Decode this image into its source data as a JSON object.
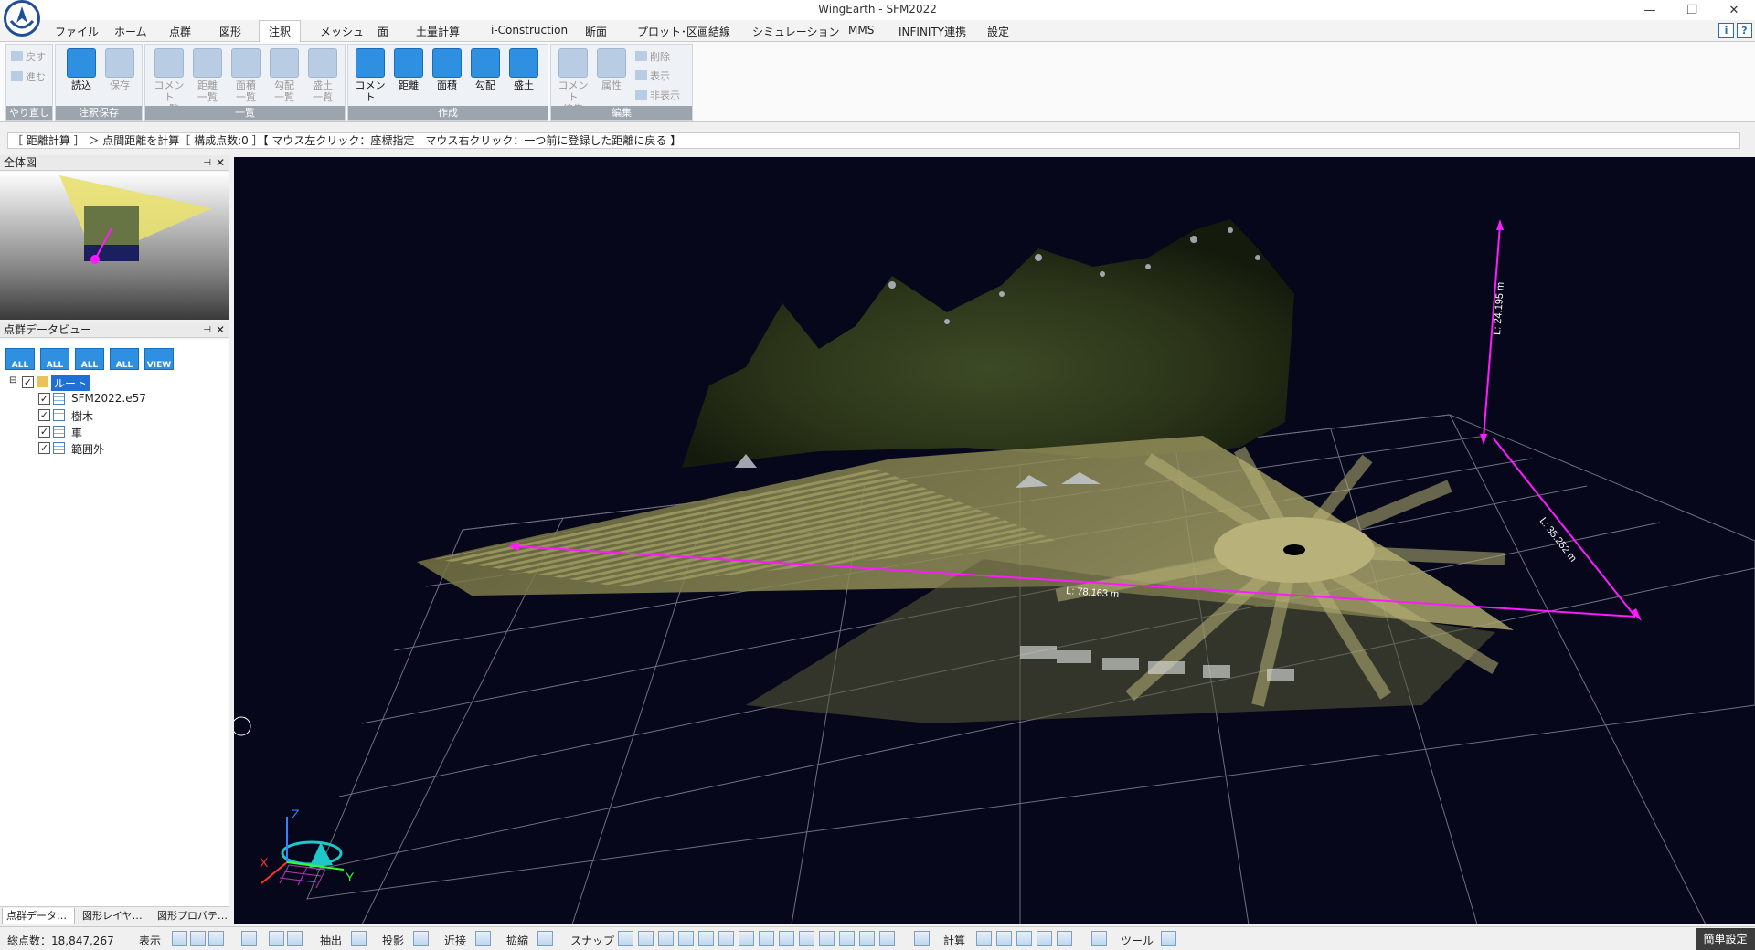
{
  "app": {
    "window_title": "WingEarth - SFM2022"
  },
  "window_controls": {
    "minimize": "—",
    "restore": "❐",
    "close": "✕"
  },
  "menu": {
    "items": [
      "ファイル",
      "ホーム",
      "点群",
      "図形",
      "注釈",
      "メッシュ",
      "面",
      "土量計算",
      "i-Construction",
      "断面",
      "プロット･区画結線",
      "シミュレーション",
      "MMS",
      "INFINITY連携",
      "設定"
    ],
    "active": "注釈",
    "help_icons": [
      "i",
      "?"
    ]
  },
  "ribbon": {
    "undo_group": {
      "undo": "戻す",
      "redo": "進む",
      "label": "やり直し"
    },
    "save_group": {
      "load": "読込",
      "save": "保存",
      "label": "注釈保存"
    },
    "list_group": {
      "items": [
        [
          "コメント",
          "一覧"
        ],
        [
          "距離",
          "一覧"
        ],
        [
          "面積",
          "一覧"
        ],
        [
          "勾配",
          "一覧"
        ],
        [
          "盛土",
          "一覧"
        ]
      ],
      "label": "一覧"
    },
    "create_group": {
      "items": [
        "コメント",
        "距離",
        "面積",
        "勾配",
        "盛土"
      ],
      "label": "作成"
    },
    "edit_group": {
      "comment_edit": [
        "コメント",
        "編集"
      ],
      "attribute": "属性",
      "delete": "削除",
      "show": "表示",
      "hide": "非表示",
      "label": "編集"
    }
  },
  "status_strip": "［ 距離計算 ］ ＞ 点間距離を計算［ 構成点数:0 ］【 マウス左クリック：座標指定　マウス右クリック：一つ前に登録した距離に戻る 】",
  "overview_panel": {
    "title": "全体図"
  },
  "pointcloud_panel": {
    "title": "点群データビュー",
    "tools": [
      "ALL",
      "ALL",
      "ALL",
      "ALL",
      "VIEW"
    ],
    "tree": [
      {
        "label": "ルート",
        "checked": true
      },
      {
        "label": "SFM2022.e57",
        "checked": true
      },
      {
        "label": "樹木",
        "checked": true
      },
      {
        "label": "車",
        "checked": true
      },
      {
        "label": "範囲外",
        "checked": true
      }
    ]
  },
  "panel_tabs": [
    "点群データ…",
    "図形レイヤ…",
    "図形プロパテ…"
  ],
  "viewport": {
    "measurements": [
      "L: 24.195 m",
      "L: 35.252 m",
      "L: 78.163 m"
    ],
    "axis_labels": {
      "x": "X",
      "y": "Y",
      "z": "Z"
    },
    "measure_color": "#ff1aff"
  },
  "status_bar": {
    "total_points": "総点数：18,847,267",
    "labels": [
      "表示",
      "抽出",
      "投影",
      "近接",
      "拡縮",
      "スナップ",
      "計算",
      "ツール"
    ],
    "easy_settings": "簡単設定"
  }
}
